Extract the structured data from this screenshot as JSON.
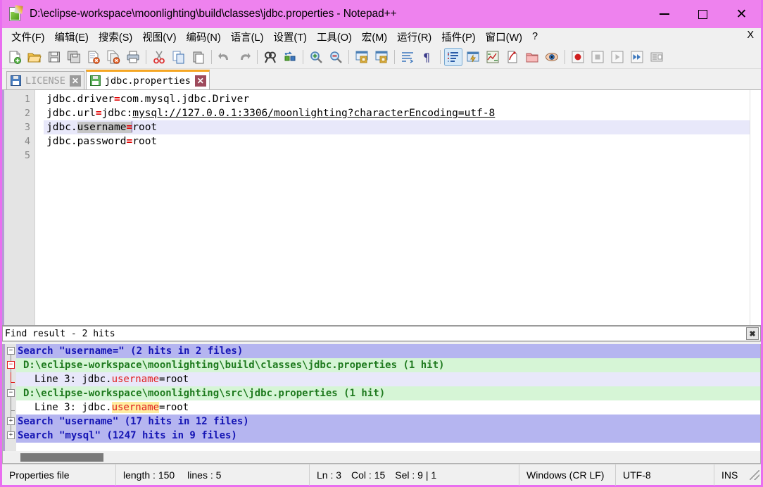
{
  "window": {
    "title": "D:\\eclipse-workspace\\moonlighting\\build\\classes\\jdbc.properties - Notepad++",
    "titlebar_color": "#ee82ee",
    "border_color": "#e96ef0",
    "controls": {
      "minimize": "—",
      "maximize": "□",
      "close": "✕"
    }
  },
  "menubar": {
    "items": [
      {
        "label": "文件(F)"
      },
      {
        "label": "编辑(E)"
      },
      {
        "label": "搜索(S)"
      },
      {
        "label": "视图(V)"
      },
      {
        "label": "编码(N)"
      },
      {
        "label": "语言(L)"
      },
      {
        "label": "设置(T)"
      },
      {
        "label": "工具(O)"
      },
      {
        "label": "宏(M)"
      },
      {
        "label": "运行(R)"
      },
      {
        "label": "插件(P)"
      },
      {
        "label": "窗口(W)"
      },
      {
        "label": "?"
      }
    ],
    "close_document": "X"
  },
  "toolbar": {
    "groups": [
      [
        "new-file-icon",
        "open-file-icon",
        "save-icon",
        "save-all-icon",
        "close-file-icon",
        "close-all-icon",
        "print-icon"
      ],
      [
        "cut-icon",
        "copy-icon",
        "paste-icon"
      ],
      [
        "undo-icon",
        "redo-icon"
      ],
      [
        "find-icon",
        "replace-icon"
      ],
      [
        "zoom-in-icon",
        "zoom-out-icon"
      ],
      [
        "sync-vertical-icon",
        "sync-horizontal-icon"
      ],
      [
        "word-wrap-icon",
        "show-all-chars-icon"
      ],
      [
        "indent-guide-icon",
        "user-defined-dialog-icon",
        "document-map-icon",
        "function-list-icon",
        "folder-as-workspace-icon",
        "monitor-icon"
      ],
      [
        "macro-record-icon",
        "macro-stop-icon",
        "macro-play-icon",
        "macro-playback-multi-icon",
        "macro-save-icon"
      ]
    ],
    "active_toggle": "indent-guide-icon"
  },
  "tabs": [
    {
      "label": "LICENSE",
      "active": false,
      "icon": "save-disk-blue-icon",
      "close": "✕"
    },
    {
      "label": "jdbc.properties",
      "active": true,
      "icon": "save-disk-green-icon",
      "close": "✕"
    }
  ],
  "editor": {
    "line_numbers": [
      "1",
      "2",
      "3",
      "4",
      "5"
    ],
    "lines": [
      {
        "n": 1,
        "current": false,
        "parts": [
          {
            "t": "jdbc.driver",
            "k": "plain"
          },
          {
            "t": "=",
            "k": "eq"
          },
          {
            "t": "com.mysql.jdbc.Driver",
            "k": "plain"
          }
        ]
      },
      {
        "n": 2,
        "current": false,
        "parts": [
          {
            "t": "jdbc.url",
            "k": "plain"
          },
          {
            "t": "=",
            "k": "eq"
          },
          {
            "t": "jdbc:",
            "k": "plain"
          },
          {
            "t": "mysql://127.0.0.1:3306/moonlighting?characterEncoding=utf-8",
            "k": "url"
          }
        ]
      },
      {
        "n": 3,
        "current": true,
        "parts": [
          {
            "t": "jdbc.",
            "k": "plain"
          },
          {
            "t": "username",
            "k": "sel"
          },
          {
            "t": "=",
            "k": "sel-eq"
          },
          {
            "t": "root",
            "k": "plain"
          }
        ]
      },
      {
        "n": 4,
        "current": false,
        "parts": [
          {
            "t": "jdbc.password",
            "k": "plain"
          },
          {
            "t": "=",
            "k": "eq"
          },
          {
            "t": "root",
            "k": "plain"
          }
        ]
      },
      {
        "n": 5,
        "current": false,
        "parts": []
      }
    ]
  },
  "find_panel": {
    "header_title": "Find result - 2 hits",
    "header_close": "✖",
    "rows": [
      {
        "kind": "search",
        "fold": "minus",
        "text": "Search \"username=\" (2 hits in 2 files)",
        "parts": [
          {
            "t": "Search \"username=\" (2 hits in 2 files)",
            "k": "plain"
          }
        ]
      },
      {
        "kind": "file",
        "fold": "minus-red",
        "text": "  D:\\eclipse-workspace\\moonlighting\\build\\classes\\jdbc.properties (1 hit)",
        "parts": [
          {
            "t": "D:\\eclipse-workspace\\moonlighting\\build\\classes\\jdbc.properties (1 hit)",
            "k": "plain"
          }
        ]
      },
      {
        "kind": "hit",
        "current": true,
        "fold": "tick-red",
        "text": "    Line 3: jdbc.username=root",
        "parts": [
          {
            "t": "Line 3: jdbc.",
            "k": "plain"
          },
          {
            "t": "username",
            "k": "match-red"
          },
          {
            "t": "=root",
            "k": "plain"
          }
        ]
      },
      {
        "kind": "file",
        "fold": "minus",
        "text": "  D:\\eclipse-workspace\\moonlighting\\src\\jdbc.properties (1 hit)",
        "parts": [
          {
            "t": "D:\\eclipse-workspace\\moonlighting\\src\\jdbc.properties (1 hit)",
            "k": "plain"
          }
        ]
      },
      {
        "kind": "hit",
        "current": false,
        "fold": "tick",
        "text": "    Line 3: jdbc.username=root",
        "parts": [
          {
            "t": "Line 3: jdbc.",
            "k": "plain"
          },
          {
            "t": "username",
            "k": "match-yellow"
          },
          {
            "t": "=root",
            "k": "plain"
          }
        ]
      },
      {
        "kind": "search",
        "fold": "plus",
        "text": "Search \"username\" (17 hits in 12 files)",
        "parts": [
          {
            "t": "Search \"username\" (17 hits in 12 files)",
            "k": "plain"
          }
        ]
      },
      {
        "kind": "search",
        "fold": "plus",
        "text": "Search \"mysql\" (1247 hits in 9 files)",
        "parts": [
          {
            "t": "Search \"mysql\" (1247 hits in 9 files)",
            "k": "plain"
          }
        ]
      }
    ]
  },
  "statusbar": {
    "doc_type": "Properties file",
    "length": "length : 150",
    "lines": "lines : 5",
    "ln": "Ln : 3",
    "col": "Col : 15",
    "sel": "Sel : 9 | 1",
    "eol": "Windows (CR LF)",
    "encoding": "UTF-8",
    "insert_mode": "INS"
  }
}
